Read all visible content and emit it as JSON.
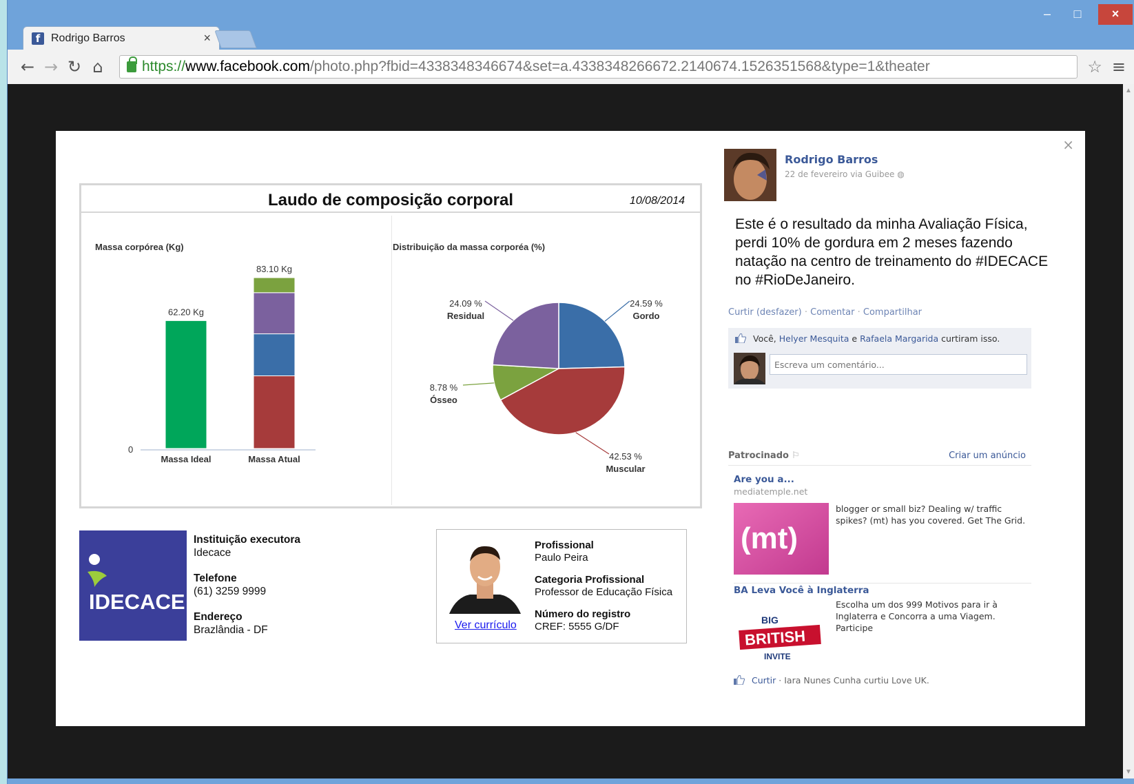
{
  "browser": {
    "tab_title": "Rodrigo Barros",
    "tab_close": "×",
    "url_scheme": "https://",
    "url_host": "www.facebook.com",
    "url_path": "/photo.php?fbid=4338348346674&set=a.4338348266672.2140674.1526351568&type=1&theater",
    "win_min": "–",
    "win_max": "□",
    "win_close": "×"
  },
  "report": {
    "title": "Laudo de composição corporal",
    "date": "10/08/2014",
    "bar_title": "Massa corpórea (Kg)",
    "pie_title": "Distribuição da massa corporéa (%)"
  },
  "chart_data": [
    {
      "type": "bar",
      "title": "Massa corpórea (Kg)",
      "categories": [
        "Massa Ideal",
        "Massa Atual"
      ],
      "total_labels": [
        "62.20 Kg",
        "83.10 Kg"
      ],
      "y_tick": "0",
      "ylim": [
        0,
        83.1
      ],
      "series": [
        {
          "values": [
            62.2,
            0
          ],
          "color": "#00a65a"
        },
        {
          "values": [
            0,
            35.34
          ],
          "color": "#a63b3b"
        },
        {
          "values": [
            0,
            20.43
          ],
          "color": "#3a6ea8"
        },
        {
          "values": [
            0,
            20.02
          ],
          "color": "#7b619e"
        },
        {
          "values": [
            0,
            7.3
          ],
          "color": "#7ba23f"
        }
      ]
    },
    {
      "type": "pie",
      "title": "Distribuição da massa corporéa (%)",
      "slices": [
        {
          "label": "Gordo",
          "value": 24.59,
          "value_label": "24.59 %",
          "color": "#3a6ea8"
        },
        {
          "label": "Muscular",
          "value": 42.53,
          "value_label": "42.53 %",
          "color": "#a63b3b"
        },
        {
          "label": "Ósseo",
          "value": 8.78,
          "value_label": "8.78 %",
          "color": "#7ba23f"
        },
        {
          "label": "Residual",
          "value": 24.09,
          "value_label": "24.09 %",
          "color": "#7b619e"
        }
      ]
    }
  ],
  "institution": {
    "logo_text": "IDECACE",
    "label_inst": "Instituição executora",
    "inst": "Idecace",
    "label_phone": "Telefone",
    "phone": "(61) 3259 9999",
    "label_address": "Endereço",
    "address": "Brazlândia - DF"
  },
  "professional": {
    "label_name": "Profissional",
    "name": "Paulo Peira",
    "label_category": "Categoria Profissional",
    "category": "Professor de Educação Física",
    "label_reg": "Número do registro",
    "reg": "CREF: 5555 G/DF",
    "cv_link": "Ver currículo"
  },
  "post": {
    "author": "Rodrigo Barros",
    "meta": "22 de fevereiro via Guibee",
    "text": "Este é o resultado da minha Avaliação Física, perdi 10% de gordura em 2 meses fazendo natação na centro de treinamento do #IDECACE no #RioDeJaneiro.",
    "action_like": "Curtir (desfazer)",
    "action_comment": "Comentar",
    "action_share": "Compartilhar",
    "likes_you": "Você,",
    "likes_p1": "Helyer Mesquita",
    "likes_and": "e",
    "likes_p2": "Rafaela Margarida",
    "likes_suffix": "curtiram isso.",
    "comment_placeholder": "Escreva um comentário..."
  },
  "sponsored": {
    "title": "Patrocinado",
    "create_ad": "Criar um anúncio",
    "ads": [
      {
        "title": "Are you a...",
        "domain": "mediatemple.net",
        "text": "blogger or small biz? Dealing w/ traffic spikes? (mt) has you covered. Get The Grid.",
        "img_text": "(mt)"
      },
      {
        "title": "BA Leva Você à Inglaterra",
        "text": "Escolha um dos 999 Motivos para ir à Inglaterra e Concorra a uma Viagem. Participe",
        "img_top": "BIG",
        "img_mid": "BRITISH",
        "img_bot": "INVITE"
      }
    ],
    "footer_like": "Curtir",
    "footer_text": "Iara Nunes Cunha curtiu Love UK."
  }
}
